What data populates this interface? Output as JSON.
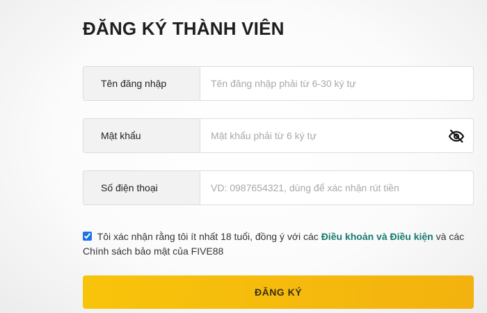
{
  "form": {
    "title": "ĐĂNG KÝ THÀNH VIÊN",
    "username": {
      "label": "Tên đăng nhập",
      "placeholder": "Tên đăng nhập phải từ 6-30 ký tự",
      "value": ""
    },
    "password": {
      "label": "Mật khẩu",
      "placeholder": "Mật khẩu phải từ 6 ký tự",
      "value": "",
      "toggle_icon": "eye-slash-icon"
    },
    "phone": {
      "label": "Số điện thoại",
      "placeholder": "VD: 0987654321, dùng để xác nhận rút tiền",
      "value": ""
    },
    "agreement": {
      "checked": true,
      "text_before": "Tôi xác nhận rằng tôi ít nhất 18 tuổi, đồng ý với các",
      "link_text": "Điều khoản và Điều kiện",
      "text_after": "và các Chính sách bảo mật của FIVE88"
    },
    "submit_label": "ĐĂNG KÝ"
  },
  "colors": {
    "accent": "#f8c40a",
    "link": "#157a6e",
    "label_bg": "#f2f2f2"
  }
}
